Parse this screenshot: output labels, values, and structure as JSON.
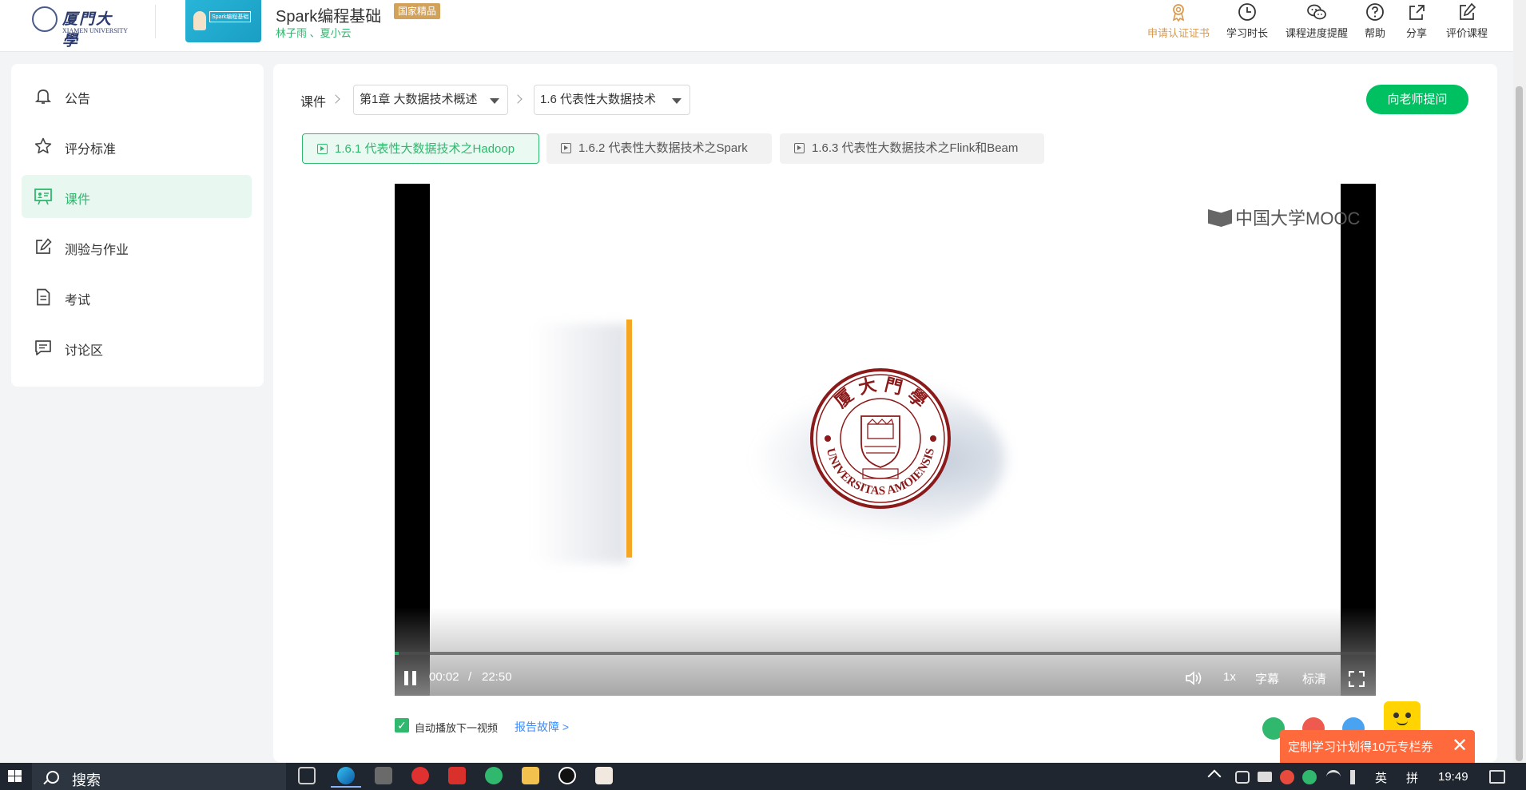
{
  "header": {
    "university_name_cn": "厦門大學",
    "university_name_en": "XIAMEN UNIVERSITY",
    "course_thumb_text": "Spark编程基础",
    "course_title": "Spark编程基础",
    "course_badge": "国家精品",
    "teachers": "林子雨 、夏小云",
    "actions": [
      {
        "label": "申请认证证书",
        "icon": "certificate-icon",
        "color": "#d99a4e"
      },
      {
        "label": "学习时长",
        "icon": "clock-icon",
        "color": "#333333"
      },
      {
        "label": "课程进度提醒",
        "icon": "wechat-icon",
        "color": "#333333"
      },
      {
        "label": "帮助",
        "icon": "help-icon",
        "color": "#333333"
      },
      {
        "label": "分享",
        "icon": "share-icon",
        "color": "#333333"
      },
      {
        "label": "评价课程",
        "icon": "edit-icon",
        "color": "#333333"
      }
    ]
  },
  "sidebar": {
    "items": [
      {
        "label": "公告",
        "icon": "bell-icon",
        "active": false
      },
      {
        "label": "评分标准",
        "icon": "star-icon",
        "active": false
      },
      {
        "label": "课件",
        "icon": "presentation-icon",
        "active": true
      },
      {
        "label": "测验与作业",
        "icon": "pencil-square-icon",
        "active": false
      },
      {
        "label": "考试",
        "icon": "document-icon",
        "active": false
      },
      {
        "label": "讨论区",
        "icon": "chat-icon",
        "active": false
      }
    ]
  },
  "breadcrumb": {
    "root": "课件",
    "chapter": "第1章 大数据技术概述",
    "section": "1.6 代表性大数据技术"
  },
  "ask_teacher_label": "向老师提问",
  "lessons": [
    {
      "label": "1.6.1 代表性大数据技术之Hadoop",
      "active": true
    },
    {
      "label": "1.6.2 代表性大数据技术之Spark",
      "active": false
    },
    {
      "label": "1.6.3 代表性大数据技术之Flink和Beam",
      "active": false
    }
  ],
  "player": {
    "watermark": "中国大学MOOC",
    "seal_top_text": "厦 大 門 學",
    "seal_bottom_text": "UNIVERSITAS AMOIENSIS",
    "current_time": "00:02",
    "separator": "/",
    "duration": "22:50",
    "progress_fraction": 0.004,
    "speed": "1x",
    "subtitle_label": "字幕",
    "quality_label": "标清",
    "state": "playing"
  },
  "below_player": {
    "autoplay_label": "自动播放下一视频",
    "autoplay_checked": true,
    "report_label": "报告故障 >"
  },
  "share_icons": [
    "wechat-share-icon",
    "weibo-share-icon",
    "qq-share-icon"
  ],
  "promo": {
    "text": "定制学习计划得10元专栏券",
    "close": "✕"
  },
  "taskbar": {
    "search_label": "搜索",
    "apps": [
      "task-view-icon",
      "edge-browser-icon",
      "app-icon",
      "netease-music-icon",
      "wps-icon",
      "wechat-app-icon",
      "file-explorer-icon",
      "qq-app-icon",
      "photo-app-icon"
    ],
    "ime_lang": "英",
    "ime_mode": "拼",
    "clock": "19:49"
  },
  "colors": {
    "accent": "#2fb86e",
    "ask_button": "#00c161",
    "promo": "#ff6a3d",
    "badge": "#d2a25a",
    "seal": "#8b1a1a"
  }
}
